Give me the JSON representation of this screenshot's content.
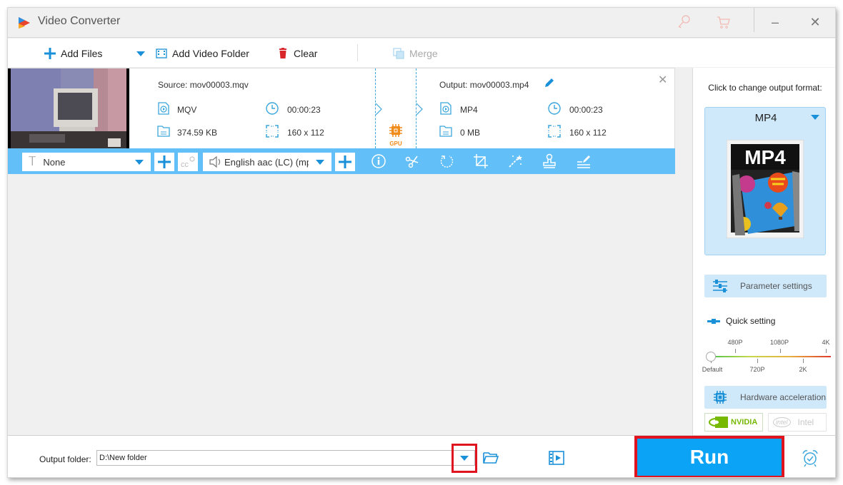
{
  "window": {
    "title": "Video Converter",
    "controls": {
      "minimize": "–",
      "close": "✕"
    },
    "title_icons": [
      "key-icon",
      "cart-icon"
    ]
  },
  "toolbar": {
    "add_files": "Add Files",
    "add_video_folder": "Add Video Folder",
    "clear": "Clear",
    "merge": "Merge"
  },
  "file": {
    "source_label": "Source: mov00003.mqv",
    "source_format": "MQV",
    "source_duration": "00:00:23",
    "source_size": "374.59 KB",
    "source_resolution": "160 x 112",
    "output_label": "Output: mov00003.mp4",
    "output_format": "MP4",
    "output_duration": "00:00:23",
    "output_size": "0 MB",
    "output_resolution": "160 x 112",
    "gpu_label": "GPU",
    "close": "✕"
  },
  "edit_bar": {
    "subtitle_icon": "T",
    "subtitle_value": "None",
    "audio_value": "English aac (LC) (mp",
    "tools": [
      "info-icon",
      "scissors-icon",
      "rotate-icon",
      "crop-icon",
      "effects-wand-icon",
      "watermark-stamp-icon",
      "metadata-edit-icon"
    ]
  },
  "right_panel": {
    "title": "Click to change output format:",
    "format": "MP4",
    "format_image_text": "MP4",
    "parameter_settings": "Parameter settings",
    "quick_setting": "Quick setting",
    "slider": {
      "top_labels": [
        "480P",
        "1080P",
        "4K"
      ],
      "bottom_labels": [
        "Default",
        "720P",
        "2K"
      ],
      "selected": "Default",
      "value_fraction": 0
    },
    "hardware_acceleration": "Hardware acceleration",
    "nvidia": "NVIDIA",
    "intel": "Intel",
    "intel_logo": "intel"
  },
  "bottom": {
    "output_folder_label": "Output folder:",
    "output_folder_value": "D:\\New folder",
    "run": "Run"
  },
  "colors": {
    "accent": "#0aa3f5",
    "edit_bar": "#63bff7",
    "highlight": "#e0141e",
    "panel_bg": "#cfe9fb",
    "gpu": "#f08c1a",
    "nvidia": "#76b900"
  }
}
